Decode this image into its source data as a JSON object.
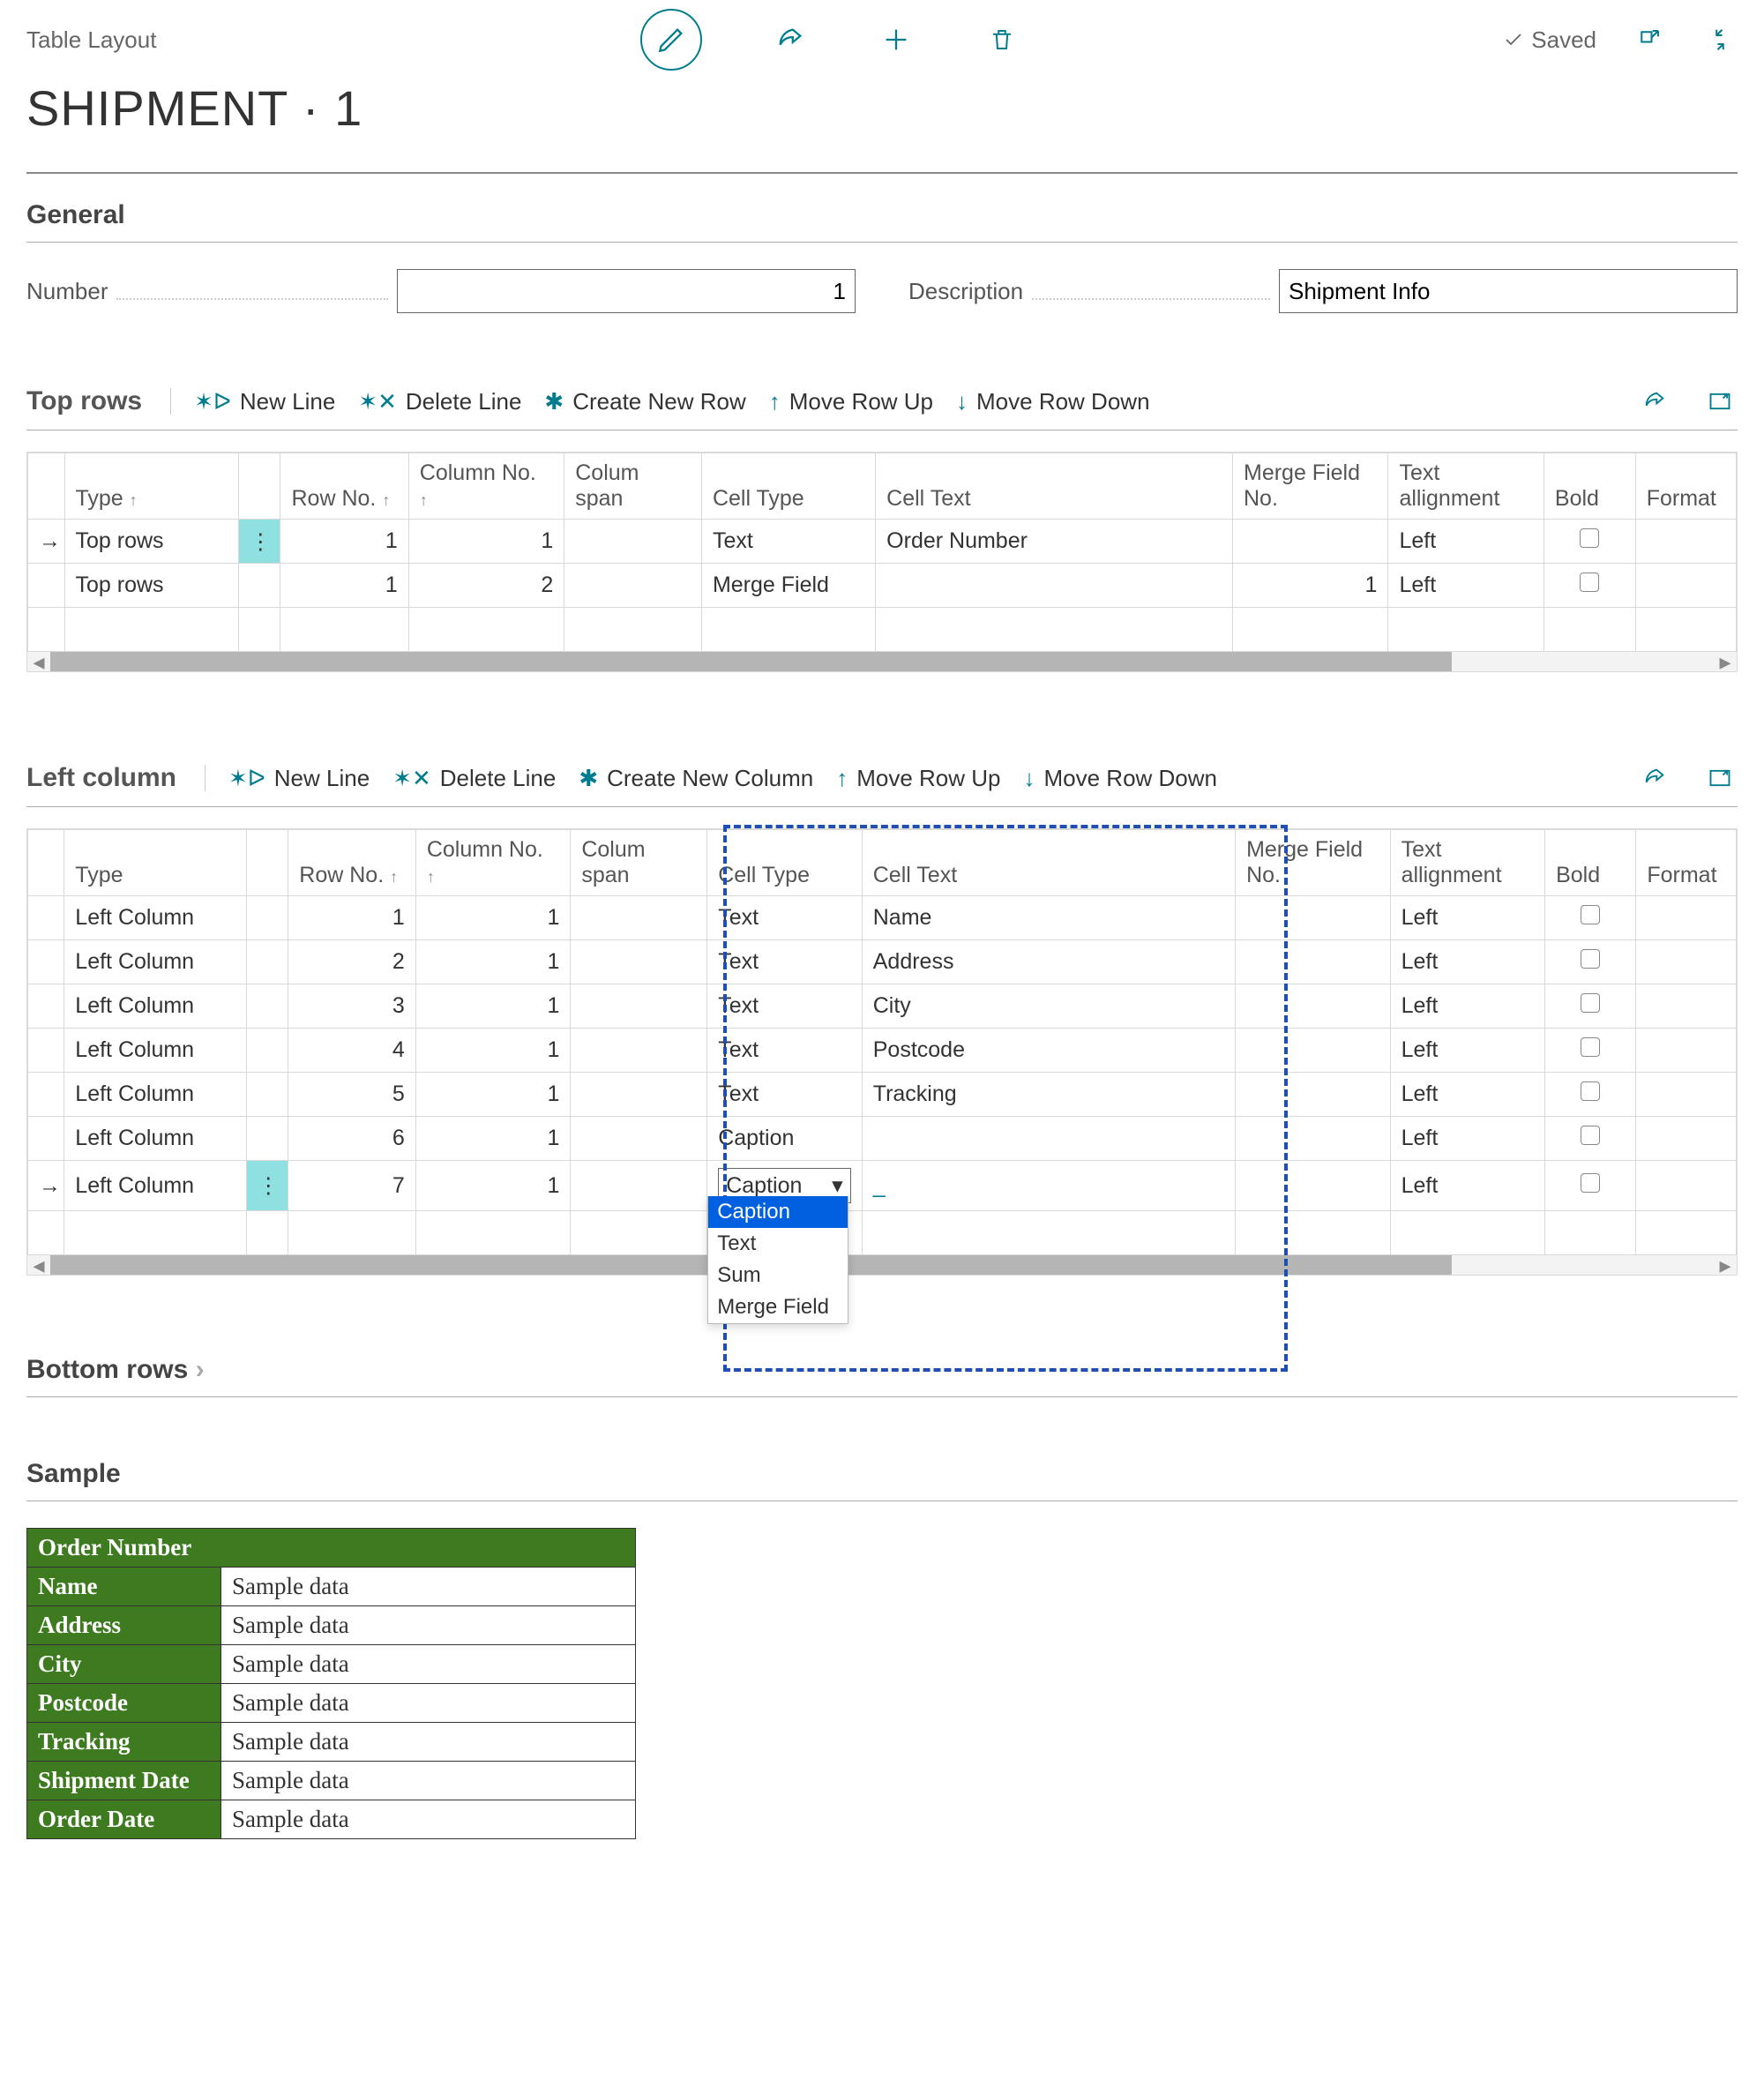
{
  "header": {
    "breadcrumb": "Table Layout",
    "saved_label": "Saved",
    "page_title": "SHIPMENT · 1"
  },
  "general": {
    "heading": "General",
    "number_label": "Number",
    "number_value": "1",
    "description_label": "Description",
    "description_value": "Shipment Info"
  },
  "grid_columns": {
    "type": "Type",
    "row_no": "Row No.",
    "column_no": "Column No.",
    "colum_span": "Colum span",
    "cell_type": "Cell Type",
    "cell_text": "Cell Text",
    "merge_field_no": "Merge Field No.",
    "text_alignment": "Text allignment",
    "bold": "Bold",
    "format": "Format"
  },
  "top_rows_section": {
    "title": "Top rows",
    "actions": {
      "new_line": "New Line",
      "delete_line": "Delete Line",
      "create_row": "Create New Row",
      "move_up": "Move Row Up",
      "move_down": "Move Row Down"
    },
    "rows": [
      {
        "type": "Top rows",
        "row_no": "1",
        "col_no": "1",
        "span": "",
        "cell_type": "Text",
        "cell_text": "Order Number",
        "merge_no": "",
        "align": "Left"
      },
      {
        "type": "Top rows",
        "row_no": "1",
        "col_no": "2",
        "span": "",
        "cell_type": "Merge Field",
        "cell_text": "",
        "merge_no": "1",
        "align": "Left"
      }
    ]
  },
  "left_column_section": {
    "title": "Left column",
    "actions": {
      "new_line": "New Line",
      "delete_line": "Delete Line",
      "create_col": "Create New Column",
      "move_up": "Move Row Up",
      "move_down": "Move Row Down"
    },
    "rows": [
      {
        "type": "Left Column",
        "row_no": "1",
        "col_no": "1",
        "span": "",
        "cell_type": "Text",
        "cell_text": "Name",
        "merge_no": "",
        "align": "Left"
      },
      {
        "type": "Left Column",
        "row_no": "2",
        "col_no": "1",
        "span": "",
        "cell_type": "Text",
        "cell_text": "Address",
        "merge_no": "",
        "align": "Left"
      },
      {
        "type": "Left Column",
        "row_no": "3",
        "col_no": "1",
        "span": "",
        "cell_type": "Text",
        "cell_text": "City",
        "merge_no": "",
        "align": "Left"
      },
      {
        "type": "Left Column",
        "row_no": "4",
        "col_no": "1",
        "span": "",
        "cell_type": "Text",
        "cell_text": "Postcode",
        "merge_no": "",
        "align": "Left"
      },
      {
        "type": "Left Column",
        "row_no": "5",
        "col_no": "1",
        "span": "",
        "cell_type": "Text",
        "cell_text": "Tracking",
        "merge_no": "",
        "align": "Left"
      },
      {
        "type": "Left Column",
        "row_no": "6",
        "col_no": "1",
        "span": "",
        "cell_type": "Caption",
        "cell_text": "",
        "merge_no": "",
        "align": "Left"
      },
      {
        "type": "Left Column",
        "row_no": "7",
        "col_no": "1",
        "span": "",
        "cell_type": "Caption",
        "cell_text": "_",
        "merge_no": "",
        "align": "Left"
      }
    ],
    "dropdown": {
      "selected": "Caption",
      "options": [
        "Caption",
        "Text",
        "Sum",
        "Merge Field"
      ]
    }
  },
  "bottom_rows_section": {
    "title": "Bottom rows"
  },
  "sample": {
    "title": "Sample",
    "header": "Order Number",
    "rows": [
      {
        "label": "Name",
        "value": "Sample data"
      },
      {
        "label": "Address",
        "value": "Sample data"
      },
      {
        "label": "City",
        "value": "Sample data"
      },
      {
        "label": "Postcode",
        "value": "Sample data"
      },
      {
        "label": "Tracking",
        "value": "Sample data"
      },
      {
        "label": "Shipment Date",
        "value": "Sample data"
      },
      {
        "label": "Order Date",
        "value": "Sample data"
      }
    ]
  }
}
